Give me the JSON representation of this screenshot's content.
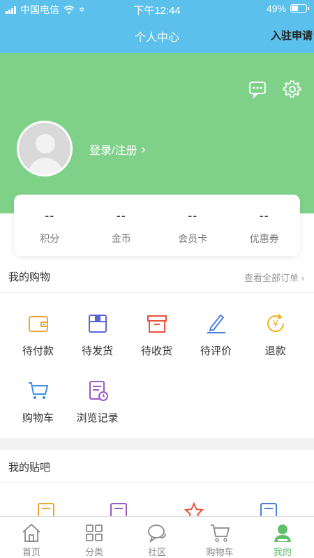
{
  "status_bar": {
    "carrier": "中国电信",
    "time": "下午12:44",
    "battery": "49%",
    "battery_level": 0.49
  },
  "header": {
    "title": "个人中心",
    "right_action": "入驻申请"
  },
  "profile": {
    "login_text": "登录/注册"
  },
  "stats": [
    {
      "value": "--",
      "label": "积分"
    },
    {
      "value": "--",
      "label": "金币"
    },
    {
      "value": "--",
      "label": "会员卡"
    },
    {
      "value": "--",
      "label": "优惠券"
    }
  ],
  "shopping": {
    "title": "我的购物",
    "more": "查看全部订单",
    "items": [
      {
        "label": "待付款",
        "icon": "wallet-icon"
      },
      {
        "label": "待发货",
        "icon": "package-icon"
      },
      {
        "label": "待收货",
        "icon": "box-icon"
      },
      {
        "label": "待评价",
        "icon": "pen-icon"
      },
      {
        "label": "退款",
        "icon": "refund-icon"
      },
      {
        "label": "购物车",
        "icon": "cart-icon"
      },
      {
        "label": "浏览记录",
        "icon": "history-icon"
      }
    ]
  },
  "tieba": {
    "title": "我的贴吧"
  },
  "tabs": [
    {
      "label": "首页",
      "icon": "home-icon"
    },
    {
      "label": "分类",
      "icon": "grid-icon"
    },
    {
      "label": "社区",
      "icon": "chat-icon"
    },
    {
      "label": "购物车",
      "icon": "cart-icon"
    },
    {
      "label": "我的",
      "icon": "user-icon"
    }
  ],
  "colors": {
    "header": "#5bc0eb",
    "profile_bg": "#7fd18a",
    "active_tab": "#5fbf6a"
  }
}
